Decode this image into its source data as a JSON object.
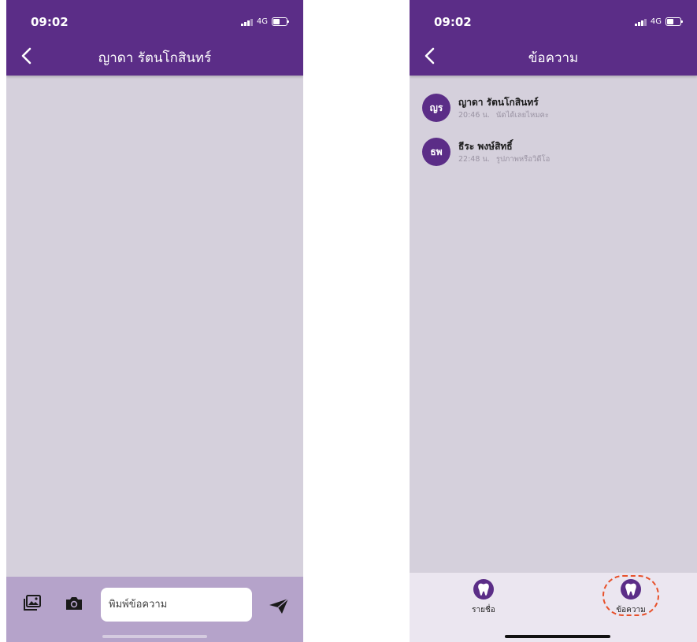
{
  "left_screen": {
    "status": {
      "time": "09:02",
      "network": "4G"
    },
    "header": {
      "title": "ญาดา รัตนโกสินทร์"
    },
    "composer": {
      "placeholder": "พิมพ์ข้อความ"
    }
  },
  "right_screen": {
    "status": {
      "time": "09:02",
      "network": "4G"
    },
    "header": {
      "title": "ข้อความ"
    },
    "conversations": [
      {
        "initials": "ญร",
        "name": "ญาดา รัตนโกสินทร์",
        "time": "20:46 น.",
        "preview": "นัดได้เลยไหมคะ"
      },
      {
        "initials": "ธพ",
        "name": "ธีระ พงษ์สิทธิ์",
        "time": "22:48 น.",
        "preview": "รูปภาพหรือวิดีโอ"
      }
    ],
    "tabs": [
      {
        "label": "รายชื่อ",
        "icon": "tooth-icon"
      },
      {
        "label": "ข้อความ",
        "icon": "tooth-icon"
      }
    ]
  },
  "colors": {
    "header": "#5b2d87",
    "background": "#d5d0dc",
    "chat_bar": "#b5a3ca",
    "tab_bar": "#ebe6f0",
    "highlight": "#e8502a"
  }
}
